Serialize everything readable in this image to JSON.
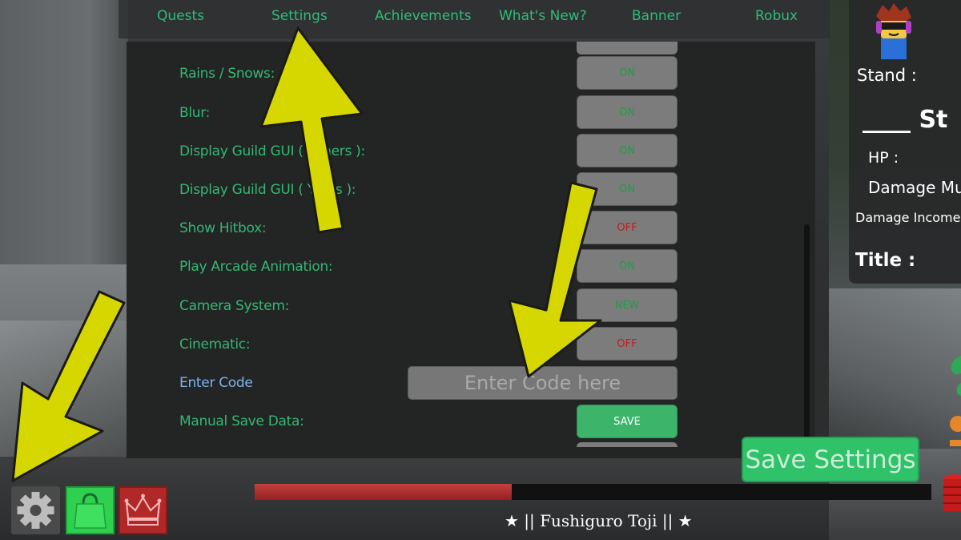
{
  "tabs": [
    {
      "label": "Quests"
    },
    {
      "label": "Settings"
    },
    {
      "label": "Achievements"
    },
    {
      "label": "What's New?"
    },
    {
      "label": "Banner"
    },
    {
      "label": "Robux"
    }
  ],
  "settings": [
    {
      "label": "Rains / Snows:",
      "value": "ON",
      "state": "on"
    },
    {
      "label": "Blur:",
      "value": "ON",
      "state": "on"
    },
    {
      "label": "Display Guild GUI ( Others ):",
      "value": "ON",
      "state": "on"
    },
    {
      "label": "Display Guild GUI ( Yours ):",
      "value": "ON",
      "state": "on"
    },
    {
      "label": "Show Hitbox:",
      "value": "OFF",
      "state": "off"
    },
    {
      "label": "Play Arcade Animation:",
      "value": "ON",
      "state": "on"
    },
    {
      "label": "Camera System:",
      "value": "NEW",
      "state": "new"
    },
    {
      "label": "Cinematic:",
      "value": "OFF",
      "state": "off"
    }
  ],
  "enter_code": {
    "label": "Enter Code",
    "placeholder": "Enter Code here",
    "value": ""
  },
  "manual_save": {
    "label": "Manual Save Data:",
    "button": "SAVE"
  },
  "stats_panel": {
    "stand_label": "Stand :",
    "stand_name": "____ St",
    "hp_label": "HP :",
    "damage_mult_label": "Damage Mult",
    "damage_income_label": "Damage Income M",
    "title_label": "Title :"
  },
  "save_settings_label": "Save Settings",
  "health_bar": {
    "fill_fraction": 0.38
  },
  "character_name": "★ || Fushiguro Toji || ★",
  "bottom_buttons": {
    "settings_icon": "gear-icon",
    "shop_icon": "shopping-bag-icon",
    "premium_icon": "crown-icon"
  },
  "colors": {
    "accent_green": "#33b874",
    "toggle_on": "#1f9c48",
    "toggle_off": "#c41c1c",
    "annotation_arrow": "#d6d600"
  }
}
